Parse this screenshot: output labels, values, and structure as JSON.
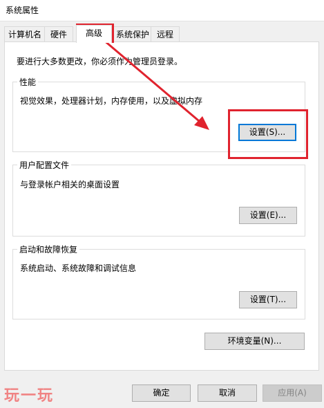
{
  "window": {
    "title": "系统属性"
  },
  "tabs": [
    {
      "label": "计算机名"
    },
    {
      "label": "硬件"
    },
    {
      "label": "高级"
    },
    {
      "label": "系统保护"
    },
    {
      "label": "远程"
    }
  ],
  "admin_note": "要进行大多数更改，你必须作为管理员登录。",
  "performance": {
    "title": "性能",
    "description": "视觉效果，处理器计划，内存使用，以及虚拟内存",
    "button": "设置(S)..."
  },
  "user_profiles": {
    "title": "用户配置文件",
    "description": "与登录帐户相关的桌面设置",
    "button": "设置(E)..."
  },
  "startup_recovery": {
    "title": "启动和故障恢复",
    "description": "系统启动、系统故障和调试信息",
    "button": "设置(T)..."
  },
  "env_button": "环境变量(N)...",
  "footer": {
    "ok": "确定",
    "cancel": "取消",
    "apply": "应用(A)"
  },
  "watermark": "玩一玩",
  "colors": {
    "highlight": "#e0232e",
    "focus": "#0078d7"
  }
}
